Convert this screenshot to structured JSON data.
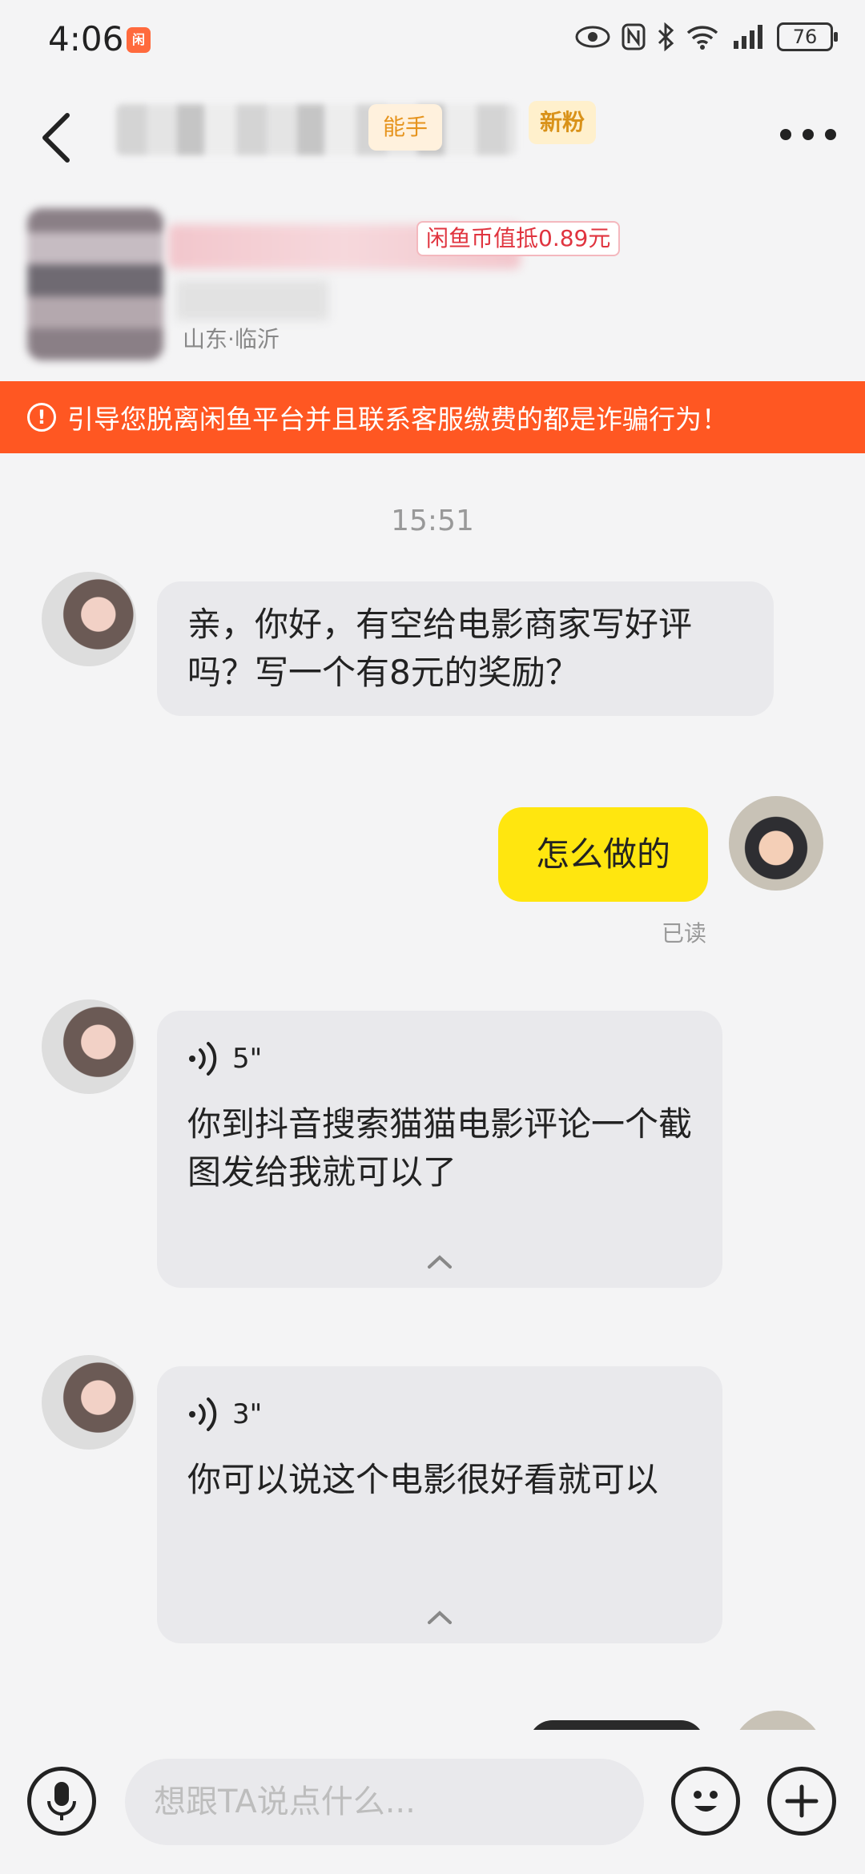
{
  "status_bar": {
    "time": "4:06",
    "app_icon_text": "闲",
    "battery": "76"
  },
  "header": {
    "tag_ability": "能手",
    "tag_new_fan": "新粉"
  },
  "product": {
    "price_tag": "闲鱼币值抵0.89元",
    "location": "山东·临沂"
  },
  "warning": {
    "icon": "!",
    "text": "引导您脱离闲鱼平台并且联系客服缴费的都是诈骗行为！"
  },
  "chat": {
    "timestamp": "15:51",
    "messages": [
      {
        "from": "other",
        "type": "text",
        "text": "亲，你好，有空给电影商家写好评吗？写一个有8元的奖励？"
      },
      {
        "from": "self",
        "type": "text",
        "text": "怎么做的",
        "status": "已读"
      },
      {
        "from": "other",
        "type": "voice",
        "duration": "5\"",
        "transcript": "你到抖音搜索猫猫电影评论一个截图发给我就可以了"
      },
      {
        "from": "other",
        "type": "voice",
        "duration": "3\"",
        "transcript": "你可以说这个电影很好看就可以"
      }
    ]
  },
  "input_bar": {
    "placeholder": "想跟TA说点什么..."
  },
  "colors": {
    "warning_bg": "#ff5722",
    "self_bubble": "#ffe60f",
    "other_bubble": "#e9e9ec",
    "background": "#f4f4f5"
  }
}
